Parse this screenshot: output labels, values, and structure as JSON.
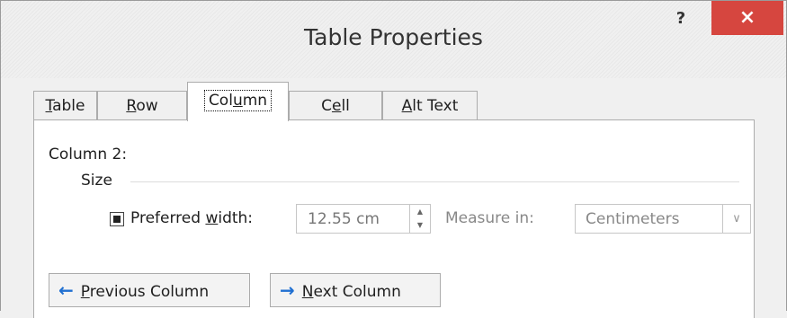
{
  "window": {
    "title": "Table Properties",
    "help_label": "?",
    "close_label": "×"
  },
  "tabs": [
    {
      "pre": "",
      "key": "T",
      "post": "able",
      "active": false
    },
    {
      "pre": "",
      "key": "R",
      "post": "ow",
      "active": false
    },
    {
      "pre": "Col",
      "key": "u",
      "post": "mn",
      "active": true
    },
    {
      "pre": "C",
      "key": "e",
      "post": "ll",
      "active": false
    },
    {
      "pre": "",
      "key": "A",
      "post": "lt Text",
      "active": false
    }
  ],
  "column": {
    "label": "Column 2:",
    "group_title": "Size",
    "preferred_width": {
      "checked": true,
      "label_pre": "Preferred ",
      "label_key": "w",
      "label_post": "idth:",
      "value": "12.55 cm"
    },
    "measure": {
      "label": "Measure in:",
      "selected": "Centimeters"
    }
  },
  "buttons": {
    "previous": {
      "arrow": "←",
      "key": "P",
      "rest": "revious Column"
    },
    "next": {
      "arrow": "→",
      "key": "N",
      "rest": "ext Column"
    }
  },
  "colors": {
    "close_bg": "#d6463f",
    "arrow_blue": "#1f6fd1"
  },
  "icons": [
    "help-icon",
    "close-icon",
    "spinner-up-icon",
    "spinner-down-icon",
    "dropdown-chevron-icon",
    "arrow-left-icon",
    "arrow-right-icon"
  ]
}
